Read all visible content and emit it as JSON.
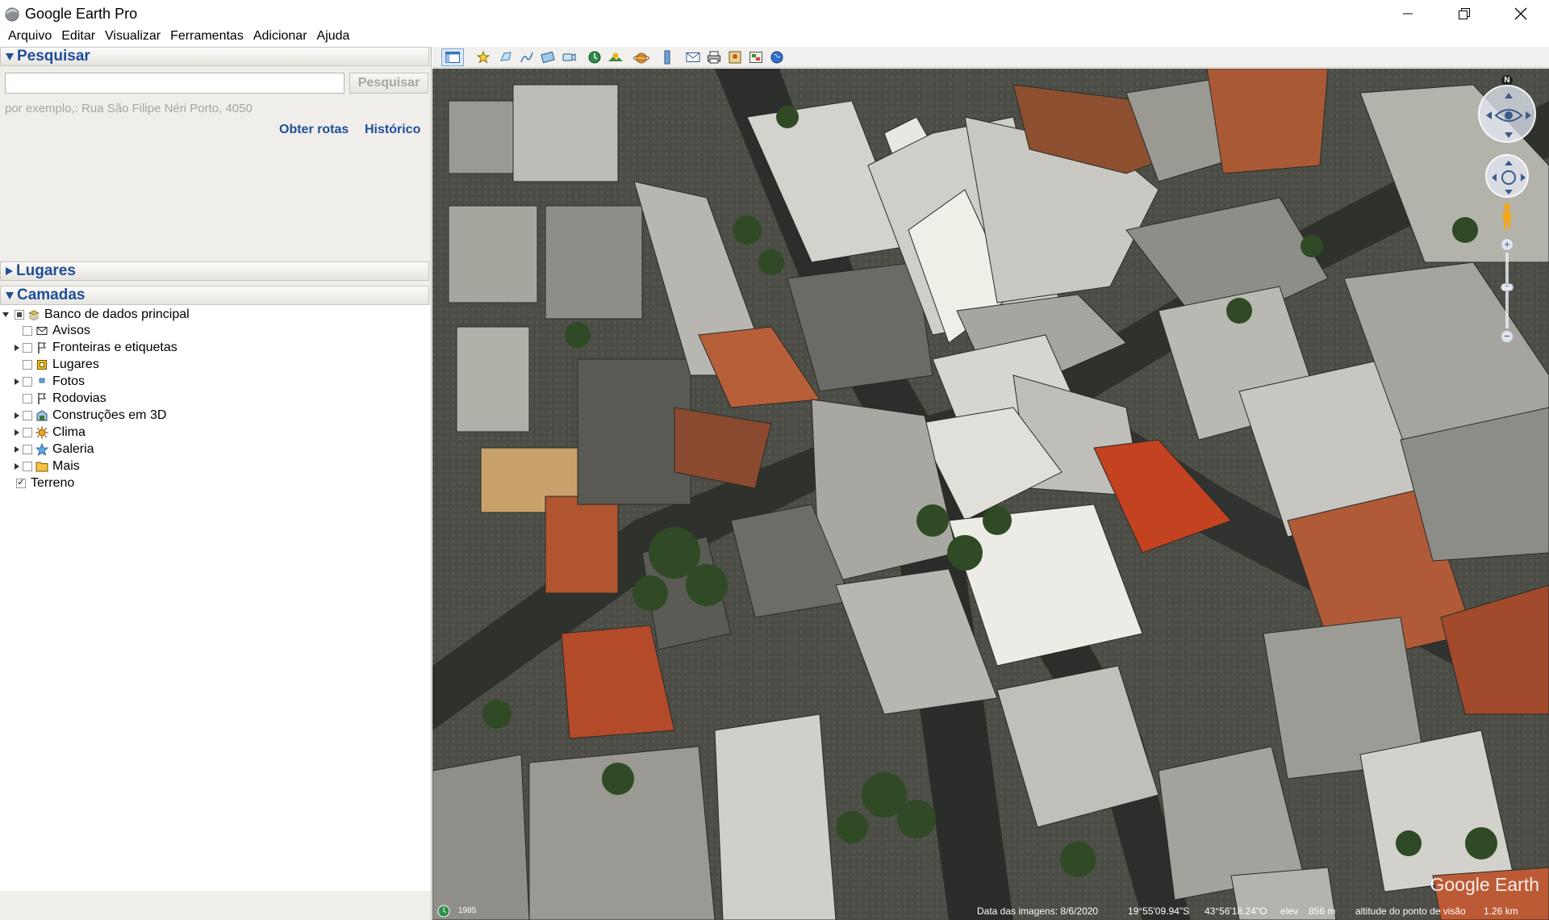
{
  "window": {
    "title": "Google Earth Pro",
    "controls": [
      "minimize",
      "maximize",
      "close"
    ]
  },
  "menu": [
    "Arquivo",
    "Editar",
    "Visualizar",
    "Ferramentas",
    "Adicionar",
    "Ajuda"
  ],
  "search": {
    "header": "Pesquisar",
    "input_value": "",
    "button_label": "Pesquisar",
    "example": "por exemplo,: Rua São Filipe Néri Porto, 4050",
    "link_routes": "Obter rotas",
    "link_history": "Histórico"
  },
  "places": {
    "header": "Lugares"
  },
  "layers": {
    "header": "Camadas",
    "root": "Banco de dados principal",
    "items": [
      {
        "label": "Avisos",
        "icon": "envelope-icon",
        "expandable": false,
        "checked": false
      },
      {
        "label": "Fronteiras e etiquetas",
        "icon": "flag-icon",
        "expandable": true,
        "checked": false
      },
      {
        "label": "Lugares",
        "icon": "place-square-icon",
        "expandable": false,
        "checked": false
      },
      {
        "label": "Fotos",
        "icon": "photo-icon",
        "expandable": true,
        "checked": false
      },
      {
        "label": "Rodovias",
        "icon": "road-icon",
        "expandable": false,
        "checked": false
      },
      {
        "label": "Construções em 3D",
        "icon": "building-3d-icon",
        "expandable": true,
        "checked": false
      },
      {
        "label": "Clima",
        "icon": "sun-icon",
        "expandable": true,
        "checked": false
      },
      {
        "label": "Galeria",
        "icon": "star-icon",
        "expandable": true,
        "checked": false
      },
      {
        "label": "Mais",
        "icon": "folder-icon",
        "expandable": true,
        "checked": false
      }
    ],
    "terrain": {
      "label": "Terreno",
      "checked": true
    }
  },
  "toolbar": {
    "icons": [
      "sidebar-toggle-icon",
      "placemark-icon",
      "polygon-icon",
      "path-icon",
      "image-overlay-icon",
      "tour-record-icon",
      "historical-imagery-icon",
      "sunlight-icon",
      "planets-icon",
      "ruler-icon",
      "email-icon",
      "print-icon",
      "save-image-icon",
      "view-maps-icon",
      "earth-view-icon"
    ]
  },
  "status": {
    "year": "1985",
    "imagery_date": "Data das imagens: 8/6/2020",
    "lat": "19°55'09.94\"S",
    "lon": "43°56'18.24\"O",
    "elev_label": "elev",
    "elev_value": "856 m",
    "eye_label": "altitude do ponto de visão",
    "eye_value": "1.26 km"
  },
  "logo": "Google Earth",
  "compass": {
    "north": "N"
  }
}
